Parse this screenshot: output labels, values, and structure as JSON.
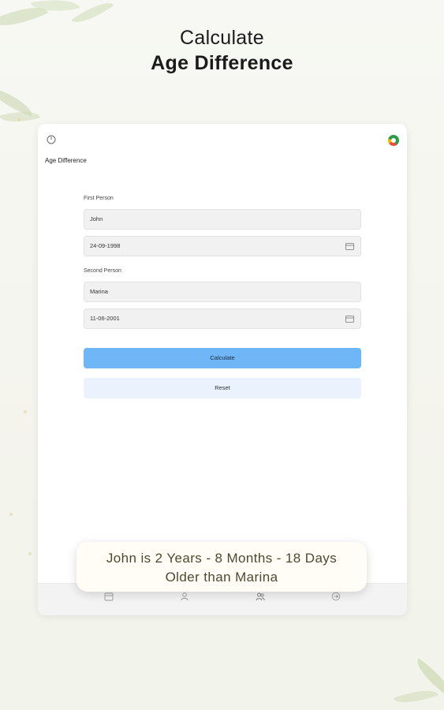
{
  "promo": {
    "headline_line1": "Calculate",
    "headline_line2": "Age Difference"
  },
  "app": {
    "screen_title": "Age Difference",
    "power_icon": "power-icon",
    "logo_icon": "app-logo"
  },
  "form": {
    "first_person_label": "First Person",
    "first_person_name": "John",
    "first_person_dob": "24-09-1998",
    "second_person_label": "Second Person",
    "second_person_name": "Marina",
    "second_person_dob": "11-06-2001"
  },
  "buttons": {
    "calculate": "Calculate",
    "reset": "Reset"
  },
  "result_toast": {
    "line1": "John is 2 Years - 8 Months - 18 Days",
    "line2": "Older than Marina"
  },
  "bottom_nav": {
    "items": [
      "calendar-icon",
      "person-icon",
      "people-icon",
      "arrow-icon"
    ]
  },
  "colors": {
    "primary_button": "#6fb6f7",
    "secondary_button": "#e9f2fd",
    "toast_text": "#4b4a30"
  }
}
